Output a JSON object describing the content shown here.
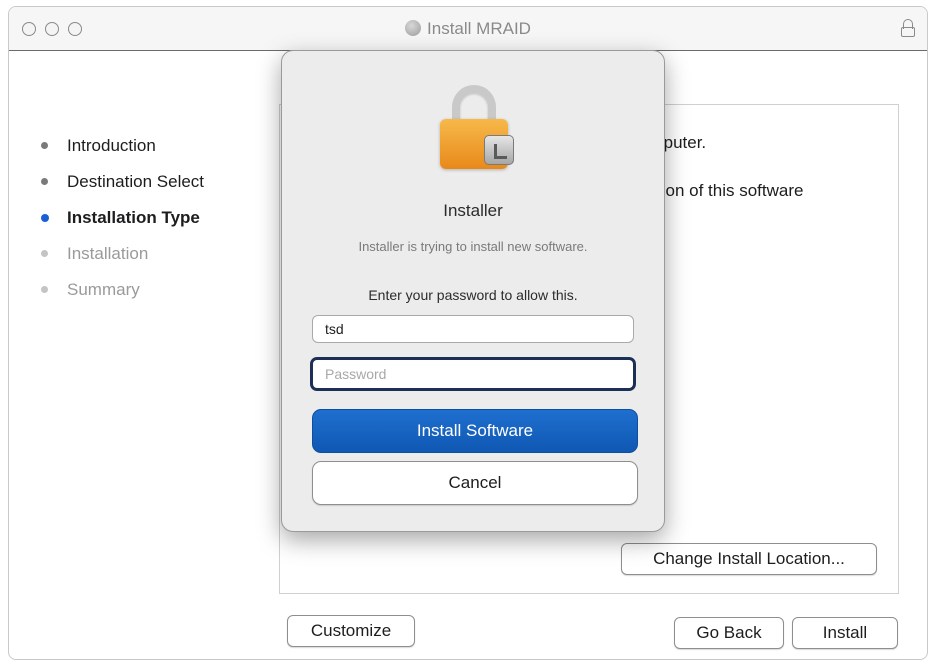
{
  "window": {
    "title": "Install MRAID"
  },
  "sidebar": {
    "steps": [
      {
        "label": "Introduction",
        "state": "done"
      },
      {
        "label": "Destination Select",
        "state": "done"
      },
      {
        "label": "Installation Type",
        "state": "active"
      },
      {
        "label": "Installation",
        "state": "pending"
      },
      {
        "label": "Summary",
        "state": "pending"
      }
    ]
  },
  "main": {
    "text_line_1": "omputer.",
    "text_line_2": "llation of this software",
    "change_location_label": "Change Install Location..."
  },
  "footer": {
    "customize_label": "Customize",
    "go_back_label": "Go Back",
    "install_label": "Install"
  },
  "dialog": {
    "title": "Installer",
    "message": "Installer is trying to install new software.",
    "prompt": "Enter your password to allow this.",
    "username_value": "tsd",
    "password_placeholder": "Password",
    "install_button_label": "Install Software",
    "cancel_button_label": "Cancel"
  },
  "colors": {
    "accent": "#1b5fd6",
    "primary_button": "#1466c4",
    "lock_body": "#f0a030"
  }
}
